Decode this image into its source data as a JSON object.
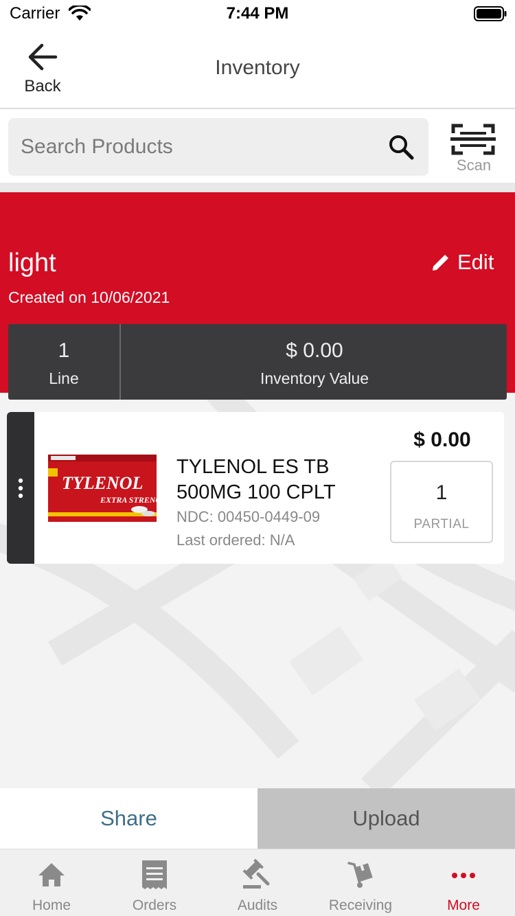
{
  "status_bar": {
    "carrier": "Carrier",
    "time": "7:44 PM"
  },
  "nav": {
    "back_label": "Back",
    "title": "Inventory"
  },
  "search": {
    "placeholder": "Search Products",
    "scan_label": "Scan"
  },
  "inventory": {
    "name": "light",
    "created": "Created on 10/06/2021",
    "edit_label": "Edit",
    "stats": {
      "line_count": "1",
      "line_label": "Line",
      "value": "$ 0.00",
      "value_label": "Inventory Value"
    }
  },
  "products": [
    {
      "name": "TYLENOL ES TB 500MG 100 CPLT",
      "ndc": "NDC: 00450-0449-09",
      "last_ordered": "Last ordered: N/A",
      "price": "$ 0.00",
      "quantity": "1",
      "unit": "PARTIAL",
      "image": {
        "brand_text": "TYLENOL",
        "variant_text": "EXTRA STRENGTH"
      }
    }
  ],
  "actions": {
    "share_label": "Share",
    "upload_label": "Upload"
  },
  "tabs": [
    {
      "label": "Home",
      "icon": "home-icon",
      "active": false
    },
    {
      "label": "Orders",
      "icon": "receipt-icon",
      "active": false
    },
    {
      "label": "Audits",
      "icon": "gavel-icon",
      "active": false
    },
    {
      "label": "Receiving",
      "icon": "hand-truck-icon",
      "active": false
    },
    {
      "label": "More",
      "icon": "more-dots-icon",
      "active": true
    }
  ],
  "colors": {
    "brand_red": "#d30d24",
    "stats_bar": "#3b3b3d",
    "share_text": "#3e6f86",
    "upload_bg": "#c2c2c2",
    "tab_inactive": "#888888"
  }
}
